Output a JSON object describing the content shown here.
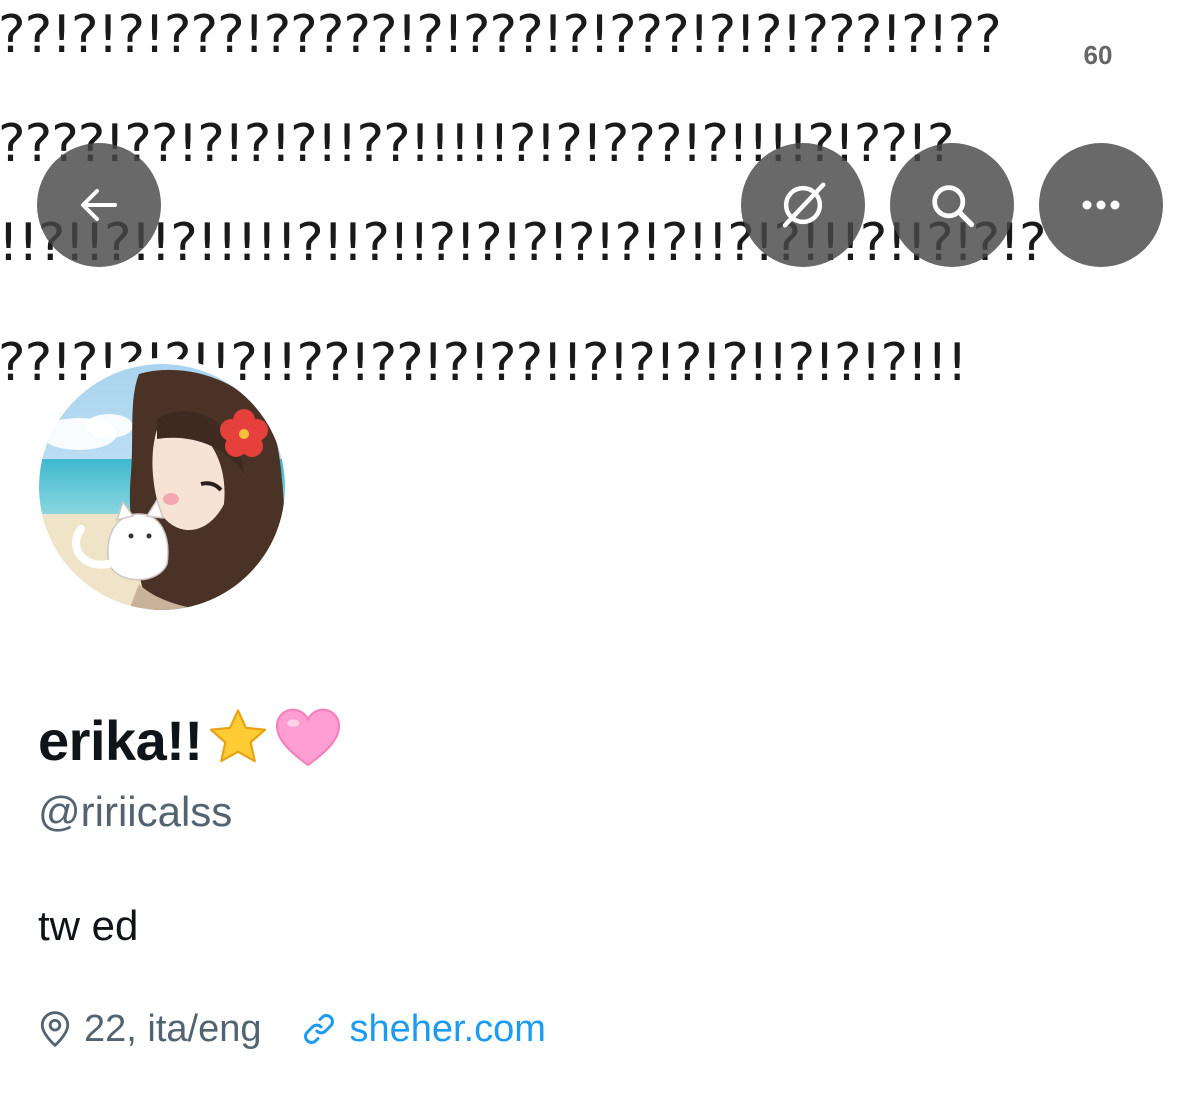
{
  "header": {
    "banner_lines": [
      "??!?!?!???!?????!?!???!?!???!?!?!???!?!??",
      "????!??!?!?!?!!??!!!!!?!?!???!?!!!!?!??!?",
      "!!?!!?!!?!!!!!?!!?!!?!?!?!?!?!?!!?!?!!!?!!?!?!?",
      "??!?!?!?!!?!!??!??!?!??!!?!?!?!?!!?!?!?!!!"
    ],
    "frame_counter": "60",
    "buttons": {
      "back": "arrow-left-icon",
      "grok": "grok-icon",
      "search": "search-icon",
      "more": "more-horizontal-icon"
    }
  },
  "profile": {
    "display_name": "erika!!",
    "name_emojis": [
      "star-emoji",
      "pink-heart-emoji"
    ],
    "handle": "@ririicalss",
    "bio": "tw ed",
    "location": "22, ita/eng",
    "website": "sheher.com"
  },
  "colors": {
    "link": "#1d9bf0",
    "secondary_text": "#536471",
    "primary_text": "#0f1419",
    "overlay_button": "#484848"
  }
}
